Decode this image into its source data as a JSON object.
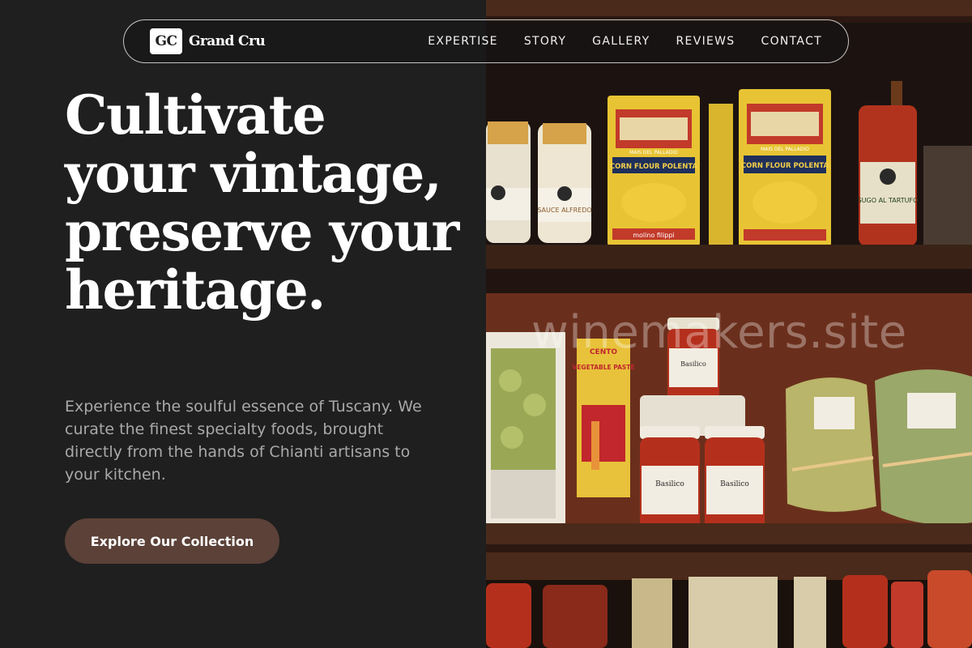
{
  "header": {
    "logo_mark": "GC",
    "brand_name": "Grand Cru",
    "nav": [
      {
        "label": "EXPERTISE"
      },
      {
        "label": "STORY"
      },
      {
        "label": "GALLERY"
      },
      {
        "label": "REVIEWS"
      },
      {
        "label": "CONTACT"
      }
    ]
  },
  "hero": {
    "title": "Cultivate your vintage, preserve your heritage.",
    "subtitle": "Experience the soulful essence of Tuscany. We curate the finest specialty foods, brought directly from the hands of Chianti artisans to your kitchen.",
    "cta_label": "Explore Our Collection"
  },
  "image": {
    "watermark": "winemakers.site",
    "labels": {
      "polenta_brand": "MAIS DEL PALLADIO",
      "polenta_name": "CORN FLOUR POLENTA",
      "polenta_maker": "molino filippi",
      "sauce_name": "SAUCE ALFREDO",
      "tartufo": "SUGO AL TARTUFO",
      "cento_brand": "CENTO",
      "cento_name": "VEGETABLE PASTE",
      "basilico": "Basilico"
    }
  },
  "colors": {
    "background": "#1f1f1f",
    "cta": "#5b4138",
    "subtitle_text": "#a9a9a9"
  }
}
